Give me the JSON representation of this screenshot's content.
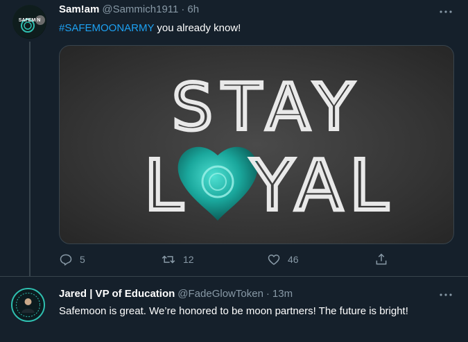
{
  "tweets": [
    {
      "name": "Sam!am",
      "handle": "@Sammich1911",
      "dot": "·",
      "time": "6h",
      "text_hashtag": "#SAFEMOONARMY",
      "text_rest": " you already know!",
      "avatar_text": "SAFEM N",
      "media_text_line1": "STAY",
      "media_text_line2_left": "L",
      "media_text_line2_right": "YAL",
      "counts": {
        "reply": "5",
        "retweet": "12",
        "like": "46"
      }
    },
    {
      "name": "Jared | VP of Education",
      "handle": "@FadeGlowToken",
      "dot": "·",
      "time": "13m",
      "text": "Safemoon is great. We’re honored to be moon partners! The future is bright!"
    }
  ],
  "icons": {
    "more": "more-horizontal-icon",
    "reply": "reply-icon",
    "retweet": "retweet-icon",
    "like": "heart-icon",
    "share": "share-icon"
  },
  "colors": {
    "background": "#15202b",
    "secondary_text": "#8899a6",
    "link": "#1da1f2",
    "divider": "#38444d",
    "accent_teal": "#2fbfb0"
  }
}
